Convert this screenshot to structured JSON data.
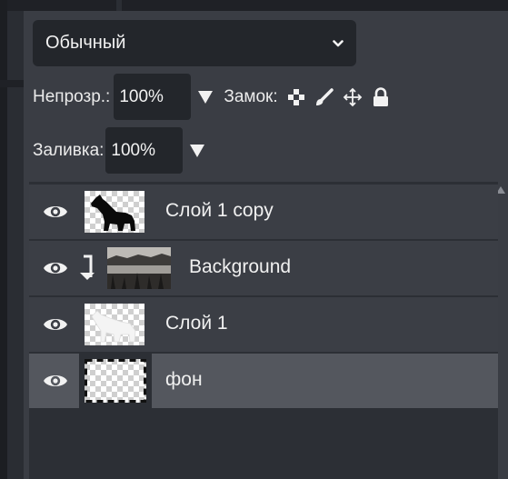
{
  "blend_mode": {
    "selected": "Обычный"
  },
  "opacity": {
    "label": "Непрозр.:",
    "value": "100%"
  },
  "lock": {
    "label": "Замок:",
    "icons": [
      "checkerboard-lock-icon",
      "brush-lock-icon",
      "move-lock-icon",
      "padlock-icon"
    ]
  },
  "fill": {
    "label": "Заливка:",
    "value": "100%"
  },
  "layers": [
    {
      "name": "Слой 1 copy",
      "visible": true,
      "thumbnail": "wolf-silhouette",
      "selected": false
    },
    {
      "name": "Background",
      "visible": true,
      "clipped": true,
      "thumbnail": "landscape-photo",
      "selected": false
    },
    {
      "name": "Слой 1",
      "visible": true,
      "thumbnail": "white-wolf",
      "selected": false
    },
    {
      "name": "фон",
      "visible": true,
      "thumbnail": "transparent",
      "selected": true
    }
  ],
  "colors": {
    "panel": "#3a3d44",
    "selected_row": "#54575e",
    "control_bg": "#23262b"
  }
}
